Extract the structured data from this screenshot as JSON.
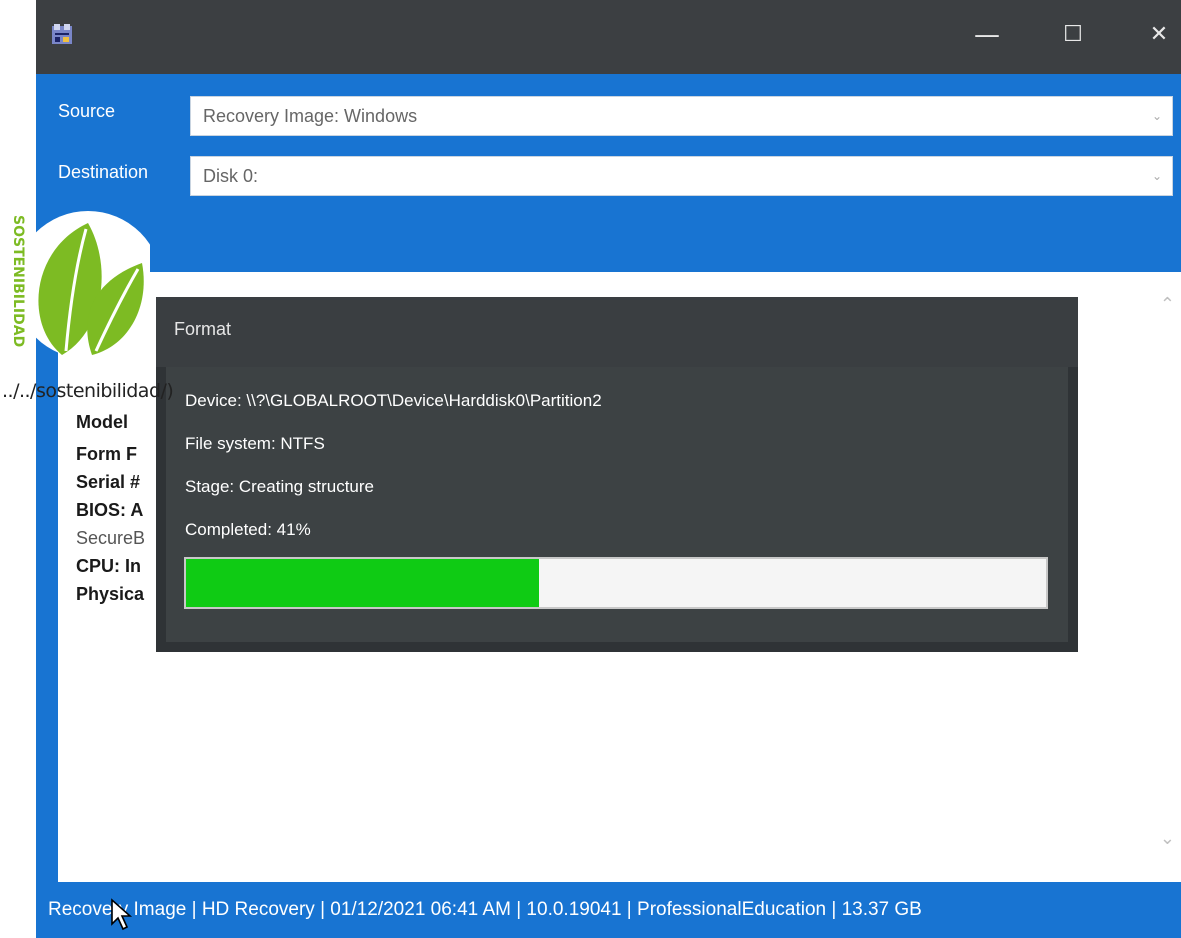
{
  "window": {
    "minimize_glyph": "—",
    "maximize_glyph": "☐",
    "close_glyph": "✕"
  },
  "form": {
    "source_label": "Source",
    "source_value": "Recovery Image: Windows",
    "destination_label": "Destination",
    "destination_value": "Disk 0:"
  },
  "info": {
    "model": "Model",
    "form_factor": "Form F",
    "serial": "Serial #",
    "bios": "BIOS: A",
    "secureboot": "SecureB",
    "cpu": "CPU: In",
    "physical": "Physica"
  },
  "dialog": {
    "title": "Format",
    "device": "Device: \\\\?\\GLOBALROOT\\Device\\Harddisk0\\Partition2",
    "file_system": "File system: NTFS",
    "stage": "Stage: Creating structure",
    "completed": "Completed: 41%",
    "progress_fraction": 0.41
  },
  "status_bar": {
    "text": "Recovery Image | HD Recovery | 01/12/2021 06:41 AM | 10.0.19041 | ProfessionalEducation | 13.37 GB"
  },
  "overlay": {
    "badge_text": "SOSTENIBILIDAD",
    "link_text": "../../sostenibilidad/)"
  },
  "colors": {
    "accent": "#1874d2",
    "titlebar": "#3c3f42",
    "progress_fill": "#0fcb14",
    "badge_green": "#7dbb23"
  },
  "icons": {
    "app": "app-icon",
    "minimize": "minimize-icon",
    "maximize": "maximize-icon",
    "close": "close-icon",
    "scroll_up": "chevron-up-icon",
    "scroll_down": "chevron-down-icon"
  }
}
